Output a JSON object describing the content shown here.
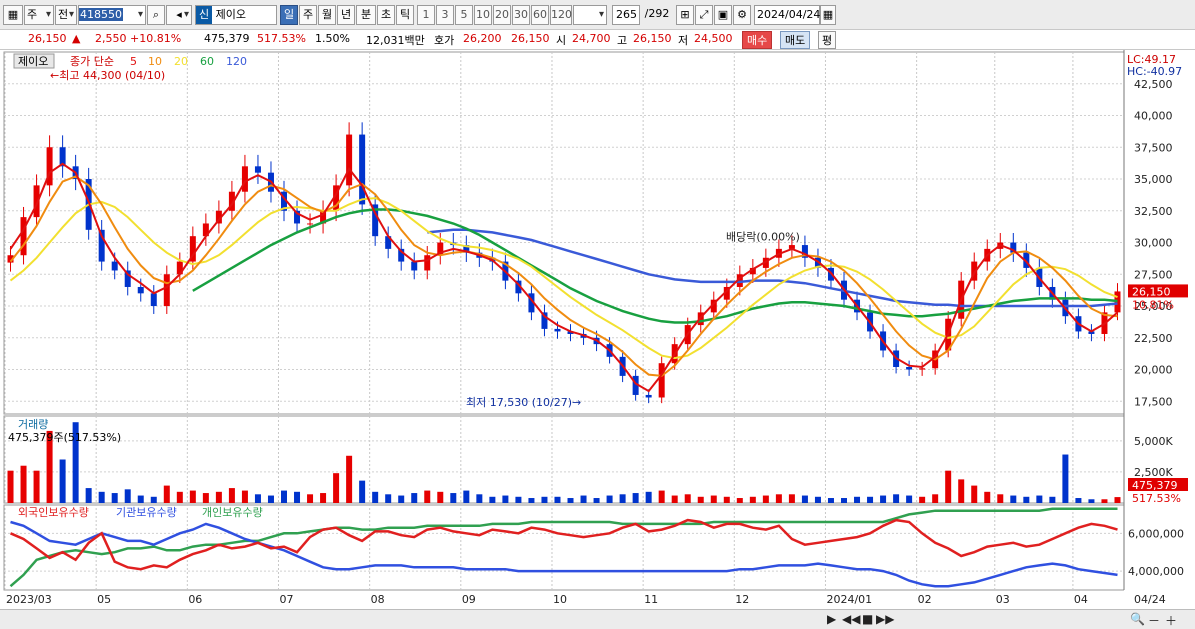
{
  "toolbar": {
    "period": "주",
    "type": "전",
    "code": "418550",
    "name": "제이오",
    "sin": "신",
    "tabs": [
      "일",
      "주",
      "월",
      "년",
      "분",
      "초",
      "틱"
    ],
    "active_tab": "일",
    "periods": [
      "1",
      "3",
      "5",
      "10",
      "20",
      "30",
      "60",
      "120"
    ],
    "count": "265",
    "total": "/292",
    "date": "2024/04/24"
  },
  "quote": {
    "price": "26,150",
    "arrow": "▲",
    "change": "2,550",
    "pct": "+10.81%",
    "volume": "475,379",
    "vol_ratio": "517.53%",
    "turnover": "1.50%",
    "amount": "12,031백만",
    "hoga_label": "호가",
    "ask": "26,200",
    "bid": "26,150",
    "open_label": "시",
    "open": "24,700",
    "high_label": "고",
    "high": "26,150",
    "low_label": "저",
    "low": "24,500",
    "buy": "매수",
    "sell": "매도",
    "flat": "평"
  },
  "chart_data": {
    "type": "line",
    "name": "제이오",
    "legend_title": "종가 단순",
    "ma_periods": [
      "5",
      "10",
      "20",
      "60",
      "120"
    ],
    "high_note": "최고 44,300 (04/10)",
    "low_note": "최저 17,530 (10/27)",
    "ex_note": "배당락(0.00%)",
    "lc": "LC:49.17",
    "hc": "HC:-40.97",
    "last_price": "26,150",
    "last_pct": "10.81%",
    "price_ticks": [
      "42,500",
      "40,000",
      "37,500",
      "35,000",
      "32,500",
      "30,000",
      "27,500",
      "25,000",
      "22,500",
      "20,000",
      "17,500"
    ],
    "ylim": [
      16500,
      45000
    ],
    "close": [
      29000,
      32000,
      34500,
      37500,
      36000,
      35000,
      31000,
      28500,
      27800,
      26500,
      26000,
      25000,
      27500,
      28500,
      30500,
      31500,
      32500,
      34000,
      36000,
      35500,
      34000,
      32500,
      31500,
      31500,
      32500,
      34500,
      38500,
      33000,
      30500,
      29500,
      28500,
      27800,
      29000,
      30000,
      29800,
      29200,
      28800,
      28500,
      27000,
      26000,
      24500,
      23200,
      23000,
      22800,
      22500,
      22000,
      21000,
      19500,
      18000,
      17800,
      20500,
      22000,
      23500,
      24500,
      25500,
      26500,
      27500,
      28000,
      28800,
      29500,
      29800,
      28800,
      28000,
      27000,
      25500,
      24500,
      23000,
      21500,
      20200,
      20000,
      20100,
      21500,
      24000,
      27000,
      28500,
      29500,
      30000,
      29200,
      28000,
      26500,
      25500,
      24200,
      23000,
      22800,
      24500,
      26150
    ],
    "ma5": [
      29500,
      31000,
      33000,
      35500,
      36200,
      35500,
      33200,
      30500,
      28800,
      27500,
      26800,
      26000,
      26500,
      27500,
      29000,
      30500,
      31800,
      33000,
      34800,
      35300,
      34800,
      33500,
      32300,
      31800,
      32200,
      33800,
      35800,
      34500,
      32300,
      30500,
      29300,
      28500,
      28600,
      29200,
      29500,
      29300,
      29000,
      28600,
      27700,
      26700,
      25500,
      24200,
      23500,
      23000,
      22700,
      22300,
      21500,
      20300,
      18900,
      18300,
      19600,
      21200,
      22800,
      24100,
      25200,
      26200,
      27200,
      27900,
      28500,
      29100,
      29500,
      29100,
      28500,
      27600,
      26300,
      25000,
      23700,
      22200,
      20900,
      20300,
      20200,
      21000,
      22800,
      25500,
      27600,
      29000,
      29800,
      29400,
      28500,
      27200,
      26000,
      24800,
      23600,
      23000,
      23600,
      24500
    ],
    "ma10": [
      28500,
      29800,
      31300,
      33200,
      34800,
      35200,
      34500,
      33000,
      31200,
      29500,
      28200,
      27200,
      26800,
      27000,
      27800,
      29000,
      30300,
      31700,
      33000,
      34000,
      34500,
      34200,
      33500,
      32800,
      32400,
      32900,
      34200,
      34600,
      33800,
      32500,
      31000,
      29800,
      29200,
      29000,
      29200,
      29300,
      29100,
      28800,
      28300,
      27600,
      26700,
      25600,
      24700,
      23900,
      23300,
      22800,
      22200,
      21400,
      20400,
      19600,
      19500,
      20300,
      21500,
      22800,
      24000,
      25100,
      26100,
      27000,
      27700,
      28300,
      28800,
      29000,
      28900,
      28500,
      27800,
      26800,
      25600,
      24300,
      23000,
      21900,
      21100,
      20800,
      21500,
      23200,
      25200,
      27200,
      28500,
      29200,
      29300,
      28800,
      28000,
      27000,
      25800,
      24800,
      24300,
      24200
    ],
    "ma20": [
      27000,
      27800,
      28800,
      30000,
      31200,
      32300,
      33000,
      33200,
      32800,
      32000,
      31000,
      30000,
      29200,
      28600,
      28300,
      28500,
      29000,
      29800,
      30700,
      31600,
      32300,
      32700,
      32800,
      32700,
      32500,
      32500,
      33000,
      33400,
      33500,
      33100,
      32500,
      31700,
      30900,
      30300,
      29900,
      29700,
      29600,
      29400,
      29100,
      28700,
      28100,
      27300,
      26500,
      25700,
      25000,
      24300,
      23700,
      23100,
      22400,
      21700,
      21100,
      20900,
      21100,
      21700,
      22500,
      23300,
      24200,
      25100,
      25900,
      26700,
      27300,
      27800,
      28100,
      28200,
      28100,
      27700,
      27100,
      26300,
      25400,
      24500,
      23600,
      22900,
      22500,
      22700,
      23400,
      24500,
      25600,
      26700,
      27500,
      28000,
      28100,
      27900,
      27400,
      26700,
      26100,
      25700
    ],
    "ma60": [
      null,
      null,
      null,
      null,
      null,
      null,
      null,
      null,
      null,
      null,
      null,
      null,
      null,
      null,
      26200,
      26800,
      27400,
      28000,
      28600,
      29200,
      29800,
      30300,
      30800,
      31200,
      31600,
      32000,
      32300,
      32500,
      32600,
      32600,
      32500,
      32300,
      32100,
      31800,
      31500,
      31100,
      30600,
      30000,
      29400,
      28800,
      28200,
      27600,
      27000,
      26400,
      25900,
      25400,
      25000,
      24600,
      24300,
      24000,
      23800,
      23700,
      23700,
      23800,
      24000,
      24200,
      24500,
      24800,
      25000,
      25200,
      25300,
      25300,
      25200,
      25100,
      25000,
      24800,
      24600,
      24400,
      24300,
      24200,
      24200,
      24300,
      24400,
      24600,
      24800,
      25000,
      25200,
      25400,
      25500,
      25600,
      25600,
      25600,
      25600,
      25500,
      25500,
      25400
    ],
    "ma120": [
      null,
      null,
      null,
      null,
      null,
      null,
      null,
      null,
      null,
      null,
      null,
      null,
      null,
      null,
      null,
      null,
      null,
      null,
      null,
      null,
      null,
      null,
      null,
      null,
      null,
      null,
      null,
      null,
      null,
      null,
      null,
      null,
      30800,
      30900,
      31000,
      31000,
      30900,
      30800,
      30600,
      30400,
      30200,
      29900,
      29600,
      29300,
      29000,
      28700,
      28400,
      28100,
      27800,
      27500,
      27300,
      27100,
      27000,
      26900,
      26900,
      26900,
      26900,
      27000,
      27000,
      27000,
      26900,
      26800,
      26600,
      26400,
      26200,
      26000,
      25800,
      25600,
      25400,
      25300,
      25200,
      25100,
      25100,
      25000,
      25000,
      25000,
      25000,
      25000,
      25000,
      25000,
      25000,
      25000,
      25000,
      25000,
      25100,
      25200
    ],
    "volume_panel": {
      "label": "거래량",
      "readout": "475,379주(517.53%)",
      "ticks": [
        "5,000K",
        "2,500K"
      ],
      "last": "475,379",
      "last_pct": "517.53%",
      "ylim": [
        0,
        7000
      ],
      "values": [
        2600,
        3000,
        2600,
        5800,
        3500,
        6500,
        1200,
        900,
        800,
        1100,
        600,
        500,
        1400,
        900,
        1000,
        800,
        900,
        1200,
        1000,
        700,
        600,
        1000,
        900,
        700,
        800,
        2400,
        3800,
        1800,
        900,
        700,
        600,
        800,
        1000,
        900,
        800,
        1000,
        700,
        500,
        600,
        500,
        400,
        500,
        500,
        400,
        600,
        400,
        600,
        700,
        800,
        900,
        1000,
        600,
        700,
        500,
        600,
        500,
        400,
        500,
        600,
        700,
        700,
        600,
        500,
        400,
        400,
        500,
        500,
        600,
        700,
        600,
        500,
        700,
        2600,
        1900,
        1400,
        900,
        700,
        600,
        500,
        600,
        500,
        3900,
        400,
        300,
        300,
        475
      ]
    },
    "holding_panel": {
      "legend": [
        "외국인보유수량",
        "기관보유수량",
        "개인보유수량"
      ],
      "ticks": [
        "6,000,000",
        "4,000,000"
      ],
      "ylim": [
        3000000,
        7500000
      ],
      "foreign": [
        6000000,
        5700000,
        5200000,
        4700000,
        5000000,
        4600000,
        5500000,
        6000000,
        4500000,
        4200000,
        4100000,
        4300000,
        4200000,
        4600000,
        4900000,
        5100000,
        5400000,
        5200000,
        5300000,
        5500000,
        5200000,
        5300000,
        5000000,
        5800000,
        6200000,
        6300000,
        5900000,
        5600000,
        6100000,
        6100000,
        5900000,
        5800000,
        6200000,
        6300000,
        6100000,
        6000000,
        5900000,
        6200000,
        6100000,
        6000000,
        6300000,
        6200000,
        6000000,
        5900000,
        5800000,
        5900000,
        6000000,
        6300000,
        6500000,
        6100000,
        6200000,
        6400000,
        6700000,
        6600000,
        6300000,
        6500000,
        6500000,
        6300000,
        6200000,
        6400000,
        5700000,
        5400000,
        5500000,
        5600000,
        5700000,
        5800000,
        6000000,
        6400000,
        6700000,
        6600000,
        6000000,
        5500000,
        5200000,
        4800000,
        5000000,
        5300000,
        5400000,
        5500000,
        5300000,
        5400000,
        5700000,
        6000000,
        6300000,
        6500000,
        6400000,
        6200000
      ],
      "institution": [
        6600000,
        6400000,
        6000000,
        5600000,
        5500000,
        5400000,
        5700000,
        6000000,
        5800000,
        5600000,
        5600000,
        5400000,
        5700000,
        6000000,
        6200000,
        6500000,
        6300000,
        6000000,
        5700000,
        5500000,
        5300000,
        5100000,
        4800000,
        4500000,
        4200000,
        4100000,
        4100000,
        4200000,
        4300000,
        4300000,
        4300000,
        4200000,
        4200000,
        4200000,
        4200000,
        4100000,
        4100000,
        4100000,
        4100000,
        4000000,
        4000000,
        4000000,
        4000000,
        4000000,
        4000000,
        4000000,
        4000000,
        4000000,
        4000000,
        4000000,
        4000000,
        4000000,
        4000000,
        4000000,
        4000000,
        4000000,
        4100000,
        4100000,
        4200000,
        4300000,
        4300000,
        4300000,
        4400000,
        4300000,
        4200000,
        4100000,
        4100000,
        4000000,
        3800000,
        3500000,
        3300000,
        3200000,
        3200000,
        3300000,
        3400000,
        3600000,
        3800000,
        4000000,
        4200000,
        4300000,
        4400000,
        4300000,
        4100000,
        4000000,
        3900000,
        3800000
      ],
      "individual": [
        3200000,
        3800000,
        4600000,
        4800000,
        5000000,
        5100000,
        5000000,
        4900000,
        5000000,
        5200000,
        5200000,
        5300000,
        5100000,
        5100000,
        5300000,
        5400000,
        5400000,
        5500000,
        5600000,
        5600000,
        5800000,
        6000000,
        6000000,
        6100000,
        6200000,
        6300000,
        6300000,
        6200000,
        6200000,
        6300000,
        6300000,
        6300000,
        6400000,
        6400000,
        6400000,
        6400000,
        6400000,
        6500000,
        6500000,
        6500000,
        6600000,
        6600000,
        6600000,
        6600000,
        6600000,
        6600000,
        6600000,
        6500000,
        6500000,
        6500000,
        6500000,
        6500000,
        6500000,
        6500000,
        6600000,
        6600000,
        6600000,
        6600000,
        6600000,
        6600000,
        6600000,
        6600000,
        6600000,
        6600000,
        6600000,
        6600000,
        6600000,
        6600000,
        6800000,
        7000000,
        7100000,
        7200000,
        7200000,
        7200000,
        7200000,
        7200000,
        7200000,
        7200000,
        7200000,
        7200000,
        7300000,
        7300000,
        7300000,
        7300000,
        7300000,
        7300000
      ]
    },
    "x_labels": [
      "2023/03",
      "05",
      "06",
      "07",
      "08",
      "09",
      "10",
      "11",
      "12",
      "2024/01",
      "02",
      "03",
      "04"
    ],
    "last_date": "04/24"
  },
  "colors": {
    "up": "#e60000",
    "down": "#0033cc",
    "ma5": "#e01010",
    "ma10": "#f08c10",
    "ma20": "#f2e030",
    "ma60": "#18a040",
    "ma120": "#3a5ad8",
    "foreign": "#e02020",
    "institution": "#3050e0",
    "individual": "#30a050"
  },
  "icons": [
    "chart-type-icon",
    "search-icon",
    "speaker-icon",
    "lock-icon",
    "gear-icon",
    "calendar-icon",
    "grid-icon"
  ],
  "bottom": {
    "buttons": [
      "▶",
      "◀◀",
      "■",
      "▶▶",
      "🔍",
      "－",
      "＋"
    ]
  }
}
